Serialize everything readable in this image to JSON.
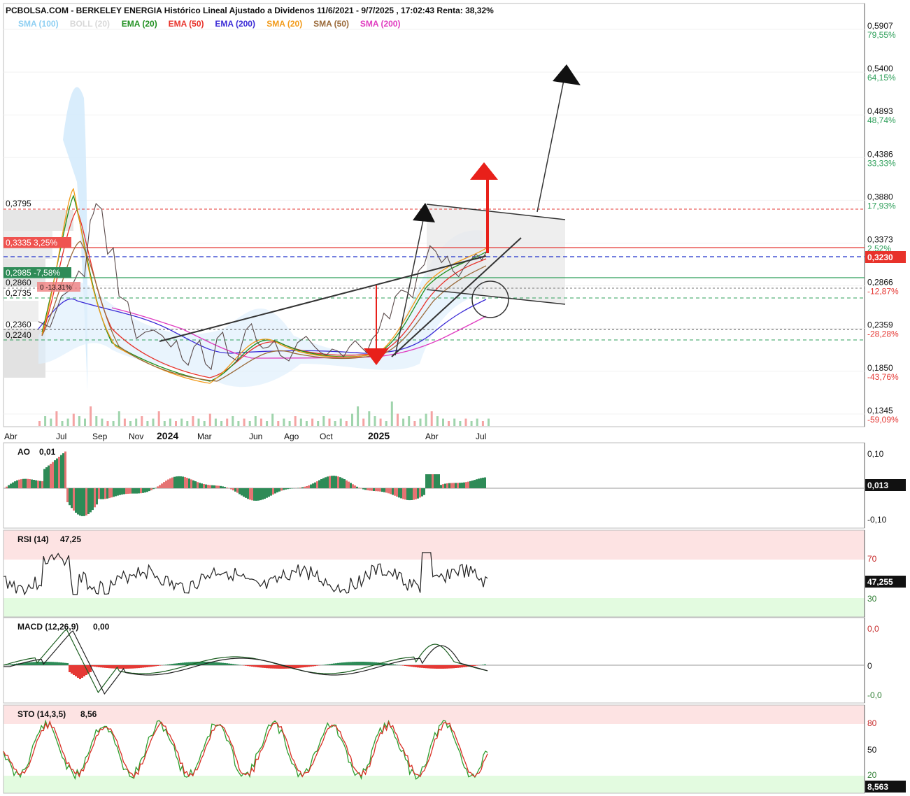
{
  "title": "PCBOLSA.COM - BERKELEY ENERGIA Histórico Lineal Ajustado a Dividenos 11/6/2021 - 9/7/2025 , 17:02:43 Renta: 38,32%",
  "legend": [
    {
      "label": "SMA (100)",
      "color": "#8ecff2"
    },
    {
      "label": "BOLL (20)",
      "color": "#d8d8d8"
    },
    {
      "label": "EMA (20)",
      "color": "#1f8f1f"
    },
    {
      "label": "EMA (50)",
      "color": "#e8322a"
    },
    {
      "label": "EMA (200)",
      "color": "#3b2bd6"
    },
    {
      "label": "SMA (20)",
      "color": "#f29a18"
    },
    {
      "label": "SMA (50)",
      "color": "#9a6a3a"
    },
    {
      "label": "SMA (200)",
      "color": "#e03cc0"
    }
  ],
  "x_labels": [
    "Abr",
    "Jul",
    "Sep",
    "Nov",
    "2024",
    "Mar",
    "Jun",
    "Ago",
    "Oct",
    "2025",
    "Abr",
    "Jul"
  ],
  "price_axis": [
    {
      "price": "0,5907",
      "pct": "79,55%"
    },
    {
      "price": "0,5400",
      "pct": "64,15%"
    },
    {
      "price": "0,4893",
      "pct": "48,74%"
    },
    {
      "price": "0,4386",
      "pct": "33,33%"
    },
    {
      "price": "0,3880",
      "pct": "17,93%"
    },
    {
      "price": "0,3373",
      "pct": "2,52%"
    },
    {
      "price": "0,2866",
      "pct": "-12,87%"
    },
    {
      "price": "0,2359",
      "pct": "-28,28%"
    },
    {
      "price": "0,1850",
      "pct": "-43,76%"
    },
    {
      "price": "0,1345",
      "pct": "-59,09%"
    }
  ],
  "current_price": "0,3230",
  "level_labels": [
    {
      "text": "0,3795"
    },
    {
      "text": "0,3335  3,25%"
    },
    {
      "text": "0,2985  -7,58%"
    },
    {
      "text": "0,2860"
    },
    {
      "text": "0  -13,31%"
    },
    {
      "text": "0,2735"
    },
    {
      "text": "0,2360"
    },
    {
      "text": "0,2240"
    }
  ],
  "panels": {
    "ao": {
      "label": "AO",
      "value": "0,01",
      "ticks": [
        "0,10",
        "-0,10"
      ],
      "current": "0,013"
    },
    "rsi": {
      "label": "RSI (14)",
      "value": "47,25",
      "ticks": [
        "70",
        "30"
      ],
      "current": "47,255"
    },
    "macd": {
      "label": "MACD (12,26,9)",
      "value": "0,00",
      "ticks": [
        "0,0",
        "0",
        "-0,0"
      ]
    },
    "sto": {
      "label": "STO (14,3,5)",
      "value": "8,56",
      "ticks": [
        "80",
        "50",
        "20"
      ],
      "current": "8,563"
    }
  },
  "chart_data": {
    "type": "line",
    "title": "PCBOLSA.COM - BERKELEY ENERGIA Histórico Lineal Ajustado a Dividenos 11/6/2021 - 9/7/2025 , 17:02:43 Renta: 38,32%",
    "ylim": [
      0.125,
      0.61
    ],
    "levels": [
      0.3795,
      0.3335,
      0.323,
      0.2985,
      0.286,
      0.2735,
      0.236,
      0.224
    ],
    "price_path": [
      [
        0,
        0.24
      ],
      [
        4,
        0.27
      ],
      [
        7,
        0.3
      ],
      [
        9,
        0.36
      ],
      [
        10,
        0.38
      ],
      [
        12,
        0.32
      ],
      [
        14,
        0.27
      ],
      [
        17,
        0.22
      ],
      [
        20,
        0.23
      ],
      [
        23,
        0.21
      ],
      [
        25,
        0.195
      ],
      [
        27,
        0.21
      ],
      [
        29,
        0.19
      ],
      [
        31,
        0.22
      ],
      [
        33,
        0.2
      ],
      [
        36,
        0.23
      ],
      [
        38,
        0.215
      ],
      [
        40,
        0.21
      ],
      [
        42,
        0.2
      ],
      [
        45,
        0.215
      ],
      [
        48,
        0.21
      ],
      [
        50,
        0.2
      ],
      [
        52,
        0.205
      ],
      [
        54,
        0.21
      ],
      [
        56,
        0.21
      ],
      [
        58,
        0.22
      ],
      [
        60,
        0.25
      ],
      [
        62,
        0.27
      ],
      [
        64,
        0.275
      ],
      [
        66,
        0.3
      ],
      [
        68,
        0.33
      ],
      [
        70,
        0.31
      ],
      [
        72,
        0.3
      ],
      [
        74,
        0.305
      ],
      [
        76,
        0.32
      ],
      [
        78,
        0.325
      ]
    ],
    "volume": [
      2,
      4,
      3,
      6,
      2,
      3,
      5,
      4,
      3,
      8,
      4,
      3,
      2,
      2,
      6,
      3,
      2,
      3,
      4,
      2,
      3,
      6,
      2,
      3,
      2,
      3,
      2,
      4,
      3,
      2,
      5,
      3,
      2,
      3,
      4,
      2,
      3,
      2,
      4,
      3,
      2,
      5,
      2,
      3,
      2,
      4,
      3,
      2,
      3,
      2,
      4,
      3,
      2,
      3,
      2,
      5,
      8,
      3,
      6,
      4,
      3,
      2,
      10,
      5,
      3,
      4,
      2,
      3,
      5,
      6,
      4,
      3,
      2,
      3,
      2,
      3,
      2,
      3,
      2,
      3
    ]
  }
}
